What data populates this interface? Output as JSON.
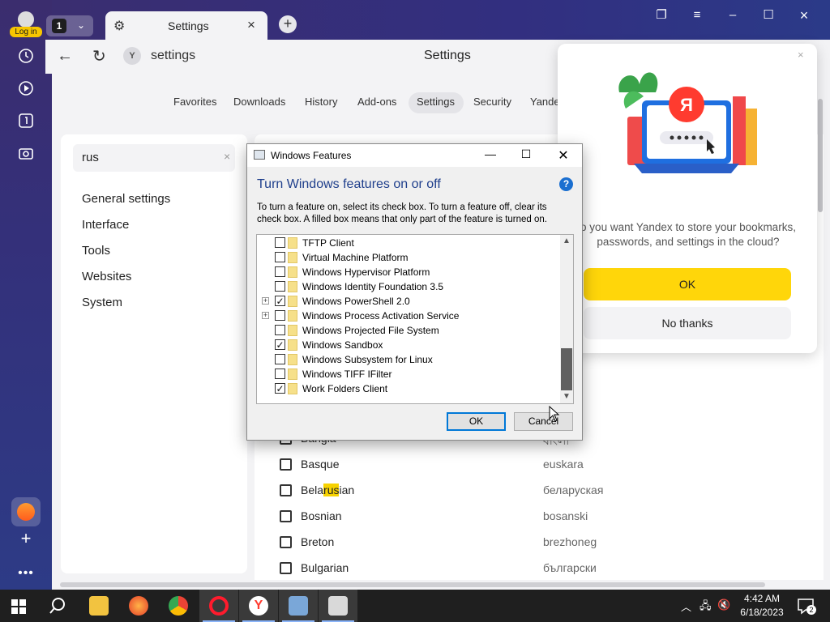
{
  "browser": {
    "login_label": "Log in",
    "tab_count": "1",
    "tab_title": "Settings",
    "address": "settings",
    "page_title": "Settings"
  },
  "settings_nav": [
    "Favorites",
    "Downloads",
    "History",
    "Add-ons",
    "Settings",
    "Security",
    "Yande"
  ],
  "search": {
    "value": "rus"
  },
  "left_menu": [
    "General settings",
    "Interface",
    "Tools",
    "Websites",
    "System"
  ],
  "languages": [
    {
      "pre": "Bangla",
      "hl": "",
      "post": "",
      "native": "বাংলা"
    },
    {
      "pre": "Basque",
      "hl": "",
      "post": "",
      "native": "euskara"
    },
    {
      "pre": "Bela",
      "hl": "rus",
      "post": "ian",
      "native": "беларуская"
    },
    {
      "pre": "Bosnian",
      "hl": "",
      "post": "",
      "native": "bosanski"
    },
    {
      "pre": "Breton",
      "hl": "",
      "post": "",
      "native": "brezhoneg"
    },
    {
      "pre": "Bulgarian",
      "hl": "",
      "post": "",
      "native": "български"
    }
  ],
  "partial_natives": [
    "ัน",
    "ıu",
    "ycan"
  ],
  "sync_popup": {
    "text": "o you want Yandex to store your bookmarks, passwords, and settings in the cloud?",
    "ok": "OK",
    "no": "No thanks"
  },
  "windows_features": {
    "title": "Windows Features",
    "heading": "Turn Windows features on or off",
    "description": "To turn a feature on, select its check box. To turn a feature off, clear its check box. A filled box means that only part of the feature is turned on.",
    "items": [
      {
        "label": "TFTP Client",
        "checked": false,
        "expandable": false
      },
      {
        "label": "Virtual Machine Platform",
        "checked": false,
        "expandable": false
      },
      {
        "label": "Windows Hypervisor Platform",
        "checked": false,
        "expandable": false
      },
      {
        "label": "Windows Identity Foundation 3.5",
        "checked": false,
        "expandable": false
      },
      {
        "label": "Windows PowerShell 2.0",
        "checked": true,
        "expandable": true
      },
      {
        "label": "Windows Process Activation Service",
        "checked": false,
        "expandable": true
      },
      {
        "label": "Windows Projected File System",
        "checked": false,
        "expandable": false
      },
      {
        "label": "Windows Sandbox",
        "checked": true,
        "expandable": false
      },
      {
        "label": "Windows Subsystem for Linux",
        "checked": false,
        "expandable": false
      },
      {
        "label": "Windows TIFF IFilter",
        "checked": false,
        "expandable": false
      },
      {
        "label": "Work Folders Client",
        "checked": true,
        "expandable": false
      }
    ],
    "ok": "OK",
    "cancel": "Cancel"
  },
  "taskbar": {
    "time": "4:42 AM",
    "date": "6/18/2023",
    "notifications": "2"
  },
  "colors": {
    "accent_yellow": "#ffd60a",
    "dialog_heading": "#1f3f8c",
    "taskbar": "#1f1f1f"
  }
}
